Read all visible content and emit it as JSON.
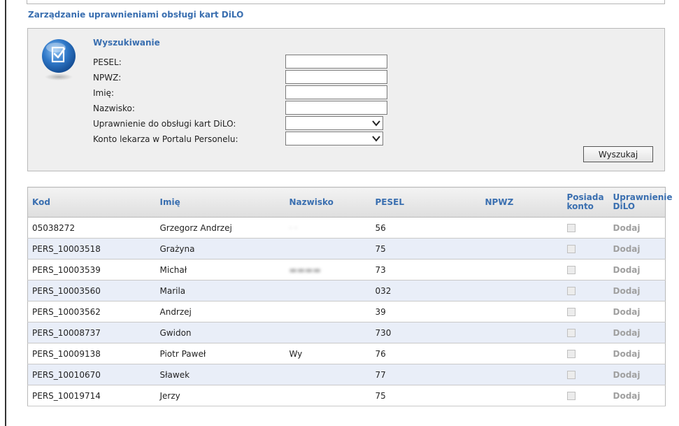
{
  "page": {
    "title": "Zarządzanie uprawnieniami obsługi kart DiLO"
  },
  "search": {
    "heading": "Wyszukiwanie",
    "fields": {
      "pesel": {
        "label": "PESEL:",
        "value": ""
      },
      "npwz": {
        "label": "NPWZ:",
        "value": ""
      },
      "imie": {
        "label": "Imię:",
        "value": ""
      },
      "nazwisko": {
        "label": "Nazwisko:",
        "value": ""
      },
      "uprawnienie": {
        "label": "Uprawnienie do obsługi kart DiLO:",
        "value": ""
      },
      "konto": {
        "label": "Konto lekarza w Portalu Personelu:",
        "value": ""
      }
    },
    "button_label": "Wyszukaj"
  },
  "table": {
    "headers": {
      "kod": "Kod",
      "imie": "Imię",
      "nazwisko": "Nazwisko",
      "pesel": "PESEL",
      "npwz": "NPWZ",
      "posiada_line1": "Posiada",
      "posiada_line2": "konto",
      "uprawnienie_line1": "Uprawnienie",
      "uprawnienie_line2": "DiLO"
    },
    "rows": [
      {
        "kod": "05038272",
        "imie": "Grzegorz Andrzej",
        "nazwisko": "",
        "pesel": "56",
        "npwz": "",
        "action": "Dodaj"
      },
      {
        "kod": "PERS_10003518",
        "imie": "Grażyna",
        "nazwisko": "",
        "pesel": "75",
        "npwz": "",
        "action": "Dodaj"
      },
      {
        "kod": "PERS_10003539",
        "imie": "Michał",
        "nazwisko": "",
        "pesel": "73",
        "npwz": "",
        "action": "Dodaj"
      },
      {
        "kod": "PERS_10003560",
        "imie": "Marila",
        "nazwisko": "",
        "pesel": "032",
        "npwz": "",
        "action": "Dodaj"
      },
      {
        "kod": "PERS_10003562",
        "imie": "Andrzej",
        "nazwisko": "",
        "pesel": "39",
        "npwz": "",
        "action": "Dodaj"
      },
      {
        "kod": "PERS_10008737",
        "imie": "Gwidon",
        "nazwisko": "",
        "pesel": "730",
        "npwz": "",
        "action": "Dodaj"
      },
      {
        "kod": "PERS_10009138",
        "imie": "Piotr Paweł",
        "nazwisko": "Wy",
        "pesel": "76",
        "npwz": "",
        "action": "Dodaj"
      },
      {
        "kod": "PERS_10010670",
        "imie": "Sławek",
        "nazwisko": "",
        "pesel": "77",
        "npwz": "",
        "action": "Dodaj"
      },
      {
        "kod": "PERS_10019714",
        "imie": "Jerzy",
        "nazwisko": "",
        "pesel": "75",
        "npwz": "",
        "action": "Dodaj"
      }
    ]
  },
  "colors": {
    "accent": "#3a6fb0",
    "row_alt": "#e9eef8",
    "panel_bg": "#efefef"
  },
  "icons": {
    "search_panel": "checklist-globe-icon",
    "select_chevron": "chevron-down-icon"
  }
}
